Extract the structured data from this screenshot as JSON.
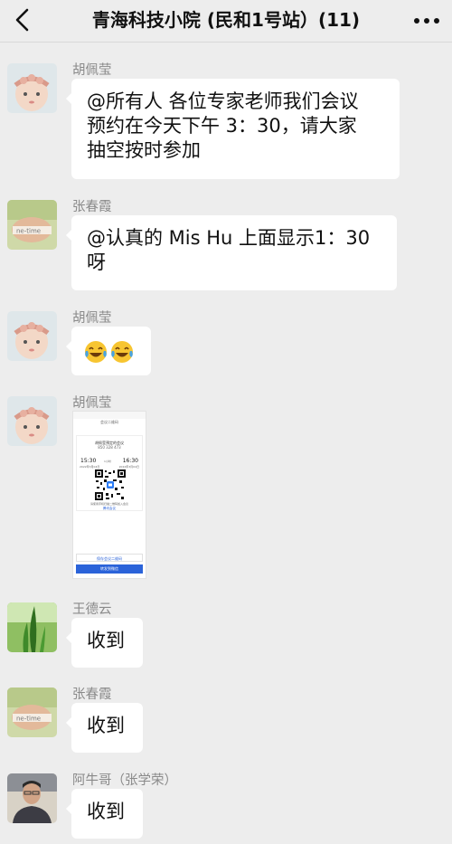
{
  "header": {
    "title": "青海科技小院 (民和1号站）(11)",
    "back_icon": "chevron-left-icon",
    "more_icon": "more-dots-icon"
  },
  "messages": [
    {
      "sender": "胡佩莹",
      "type": "text",
      "lines": [
        "@所有人 各位专家老师我们会议",
        "预约在今天下午 3：30，请大家",
        "抽空按时参加"
      ]
    },
    {
      "sender": "张春霞",
      "type": "text",
      "lines": [
        "@认真的 Mis Hu 上面显示1：30",
        "呀"
      ]
    },
    {
      "sender": "胡佩莹",
      "type": "emoji",
      "emoji": "laughing-crying-face-icon"
    },
    {
      "sender": "胡佩莹",
      "type": "image",
      "image": {
        "title": "会议二维码",
        "meeting_title": "胡佩莹预定的会议",
        "meeting_id": "850 328 473",
        "start_time": "15:30",
        "end_time": "16:30",
        "start_date": "2022年3月04日",
        "end_date": "2022年3月04日",
        "duration": "1小时",
        "hint": "请使用手机扫描二维码加入会议",
        "brand": "腾讯会议",
        "save_button": "保存会议二维码",
        "share_button": "转发到微信"
      }
    },
    {
      "sender": "王德云",
      "type": "text",
      "lines": [
        "收到"
      ]
    },
    {
      "sender": "张春霞",
      "type": "text",
      "lines": [
        "收到"
      ]
    },
    {
      "sender": "阿牛哥（张学荣）",
      "type": "text",
      "lines": [
        "收到"
      ]
    }
  ]
}
